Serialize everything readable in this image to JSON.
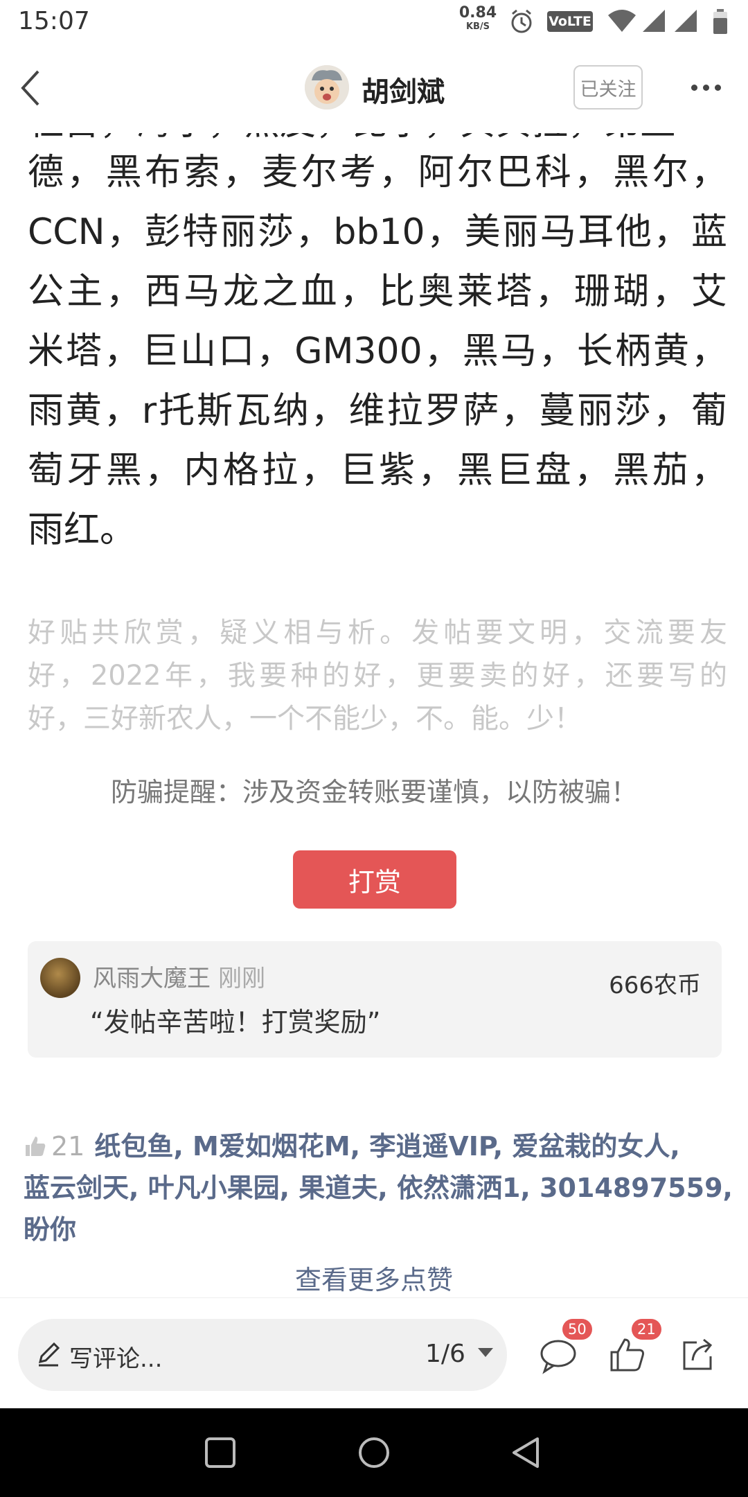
{
  "status_bar": {
    "time": "15:07",
    "net_speed_value": "0.84",
    "net_speed_unit": "KB/S",
    "volte_label": "VoLTE",
    "icons": [
      "alarm-icon",
      "volte-icon",
      "wifi-icon",
      "signal-icon",
      "signal-icon-2",
      "battery-icon"
    ]
  },
  "header": {
    "author_name": "胡剑斌",
    "follow_label": "已关注",
    "icons": [
      "back-arrow-icon",
      "more-dots-icon"
    ]
  },
  "article": {
    "clipped_top_line": "杜首，海尔，黑皮，比尔，贝贝拉，弟兰",
    "body_lines": [
      "德，黑布索，麦尔考，阿尔巴科，黑尔，",
      "CCN，彭特丽莎，bb10，美丽马耳他，蓝",
      "公主，西马龙之血，比奥莱塔，珊瑚，艾",
      "米塔，巨山口，GM300，黑马，长柄黄，",
      "雨黄，r托斯瓦纳，维拉罗萨，蔓丽莎，葡",
      "萄牙黑，内格拉，巨紫，黑巨盘，黑茄，",
      "雨红。"
    ],
    "slogan_lines": [
      "好贴共欣赏，疑义相与析。发帖要文明，交流要友",
      "好，2022年，我要种的好，更要卖的好，还要写的",
      "好，三好新农人，一个不能少，不。能。少！"
    ],
    "fraud_tip": "防骗提醒：涉及资金转账要谨慎，以防被骗！",
    "tip_button": "打赏"
  },
  "reward": {
    "user": "风雨大魔王",
    "time": "刚刚",
    "amount": "666农币",
    "message": "“发帖辛苦啦！打赏奖励”"
  },
  "likes": {
    "count": "21",
    "line1": "纸包鱼, M爱如烟花M, 李逍遥VIP, 爱盆栽的女人,",
    "line2": "蓝云剑天, 叶凡小果园, 果道夫, 依然潇洒1, 3014897559,",
    "line3": "盼你",
    "more_label": "查看更多点赞"
  },
  "action_bar": {
    "comment_placeholder": "写评论...",
    "page_indicator": "1/6",
    "comment_count": "50",
    "like_count": "21",
    "accent_color": "#e45656"
  }
}
